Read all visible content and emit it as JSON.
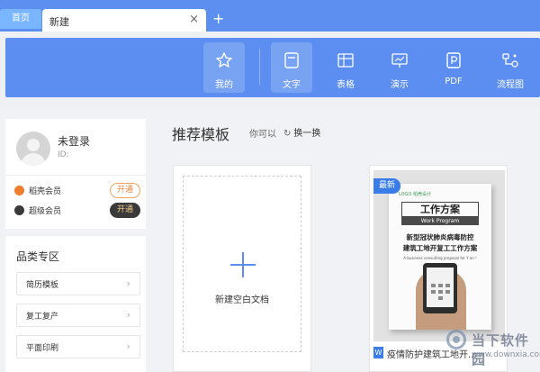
{
  "tabs": {
    "home": "首页",
    "active": "新建",
    "close": "×",
    "add": "+"
  },
  "nav": {
    "items": [
      {
        "label": "我的",
        "icon": "star-icon"
      },
      {
        "label": "文字",
        "icon": "document-icon"
      },
      {
        "label": "表格",
        "icon": "table-icon"
      },
      {
        "label": "演示",
        "icon": "presentation-icon"
      },
      {
        "label": "PDF",
        "icon": "pdf-icon"
      },
      {
        "label": "流程图",
        "icon": "flowchart-icon"
      }
    ]
  },
  "user": {
    "name": "未登录",
    "id_label": "ID:",
    "vip": [
      {
        "label": "稻壳会员",
        "button": "开通"
      },
      {
        "label": "超级会员",
        "button": "开通"
      }
    ]
  },
  "categories": {
    "title": "品类专区",
    "items": [
      "简历模板",
      "复工复产",
      "平面印刷"
    ]
  },
  "main": {
    "title": "推荐模板",
    "hint": "你可以",
    "refresh_label": "换一换",
    "blank_label": "新建空白文档",
    "template": {
      "badge": "最新",
      "type_icon": "W",
      "name": "疫情防护建筑工地开...",
      "cover": {
        "logo": "LOGO 稻壳设计",
        "heading": "工作方案",
        "heading_en": "Work Program",
        "line1": "新型冠状肺炎病毒防控",
        "line2": "建筑工地开复工工作方案",
        "subtitle": "A business consulting proposal for Y on !"
      }
    }
  },
  "watermark": {
    "text": "当下软件园",
    "url": "www.downxia.com"
  },
  "colors": {
    "tabbar": "#5c8ff0",
    "accent": "#5b8ef0",
    "badge": "#3a7de8",
    "orange": "#e9843a"
  }
}
